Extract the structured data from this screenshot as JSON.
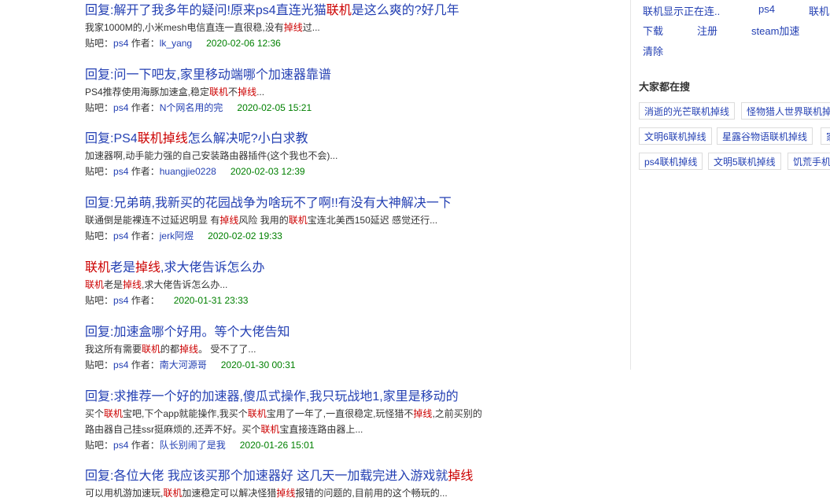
{
  "results": [
    {
      "title": "回复:解开了我多年的疑问!原来ps4直连光猫联机是这么爽的?好几年",
      "snippet": "我家1000M的,小米mesh电信直连一直很稳,没有掉线过...",
      "bar_label": "贴吧：",
      "bar": "ps4",
      "author_label": "作者：",
      "author": "lk_yang",
      "date": "2020-02-06 12:36"
    },
    {
      "title": "回复:问一下吧友,家里移动端哪个加速器靠谱",
      "snippet": "PS4推荐使用海豚加速盒,稳定联机不掉线...",
      "bar_label": "贴吧：",
      "bar": "ps4",
      "author_label": "作者：",
      "author": "N个网名用的完",
      "date": "2020-02-05 15:21"
    },
    {
      "title": "回复:PS4联机掉线怎么解决呢?小白求教",
      "snippet": "加速器啊,动手能力强的自己安装路由器插件(这个我也不会)...",
      "bar_label": "贴吧：",
      "bar": "ps4",
      "author_label": "作者：",
      "author": "huangjie0228",
      "date": "2020-02-03 12:39"
    },
    {
      "title": "回复:兄弟萌,我新买的花园战争为啥玩不了啊!!有没有大神解决一下",
      "snippet": "联通倒是能裸连不过延迟明显 有掉线风险 我用的联机宝连北美西150延迟 感觉还行...",
      "bar_label": "贴吧：",
      "bar": "ps4",
      "author_label": "作者：",
      "author": "jerk阿煜",
      "date": "2020-02-02 19:33"
    },
    {
      "title": "联机老是掉线,求大佬告诉怎么办",
      "snippet": "联机老是掉线,求大佬告诉怎么办...",
      "bar_label": "贴吧：",
      "bar": "ps4",
      "author_label": "作者：",
      "author": "",
      "date": "2020-01-31 23:33"
    },
    {
      "title": "回复:加速盒哪个好用。等个大佬告知",
      "snippet": "我这所有需要联机的都掉线。 受不了了...",
      "bar_label": "贴吧：",
      "bar": "ps4",
      "author_label": "作者：",
      "author": "南大河源哥",
      "date": "2020-01-30 00:31"
    },
    {
      "title": "回复:求推荐一个好的加速器,傻瓜式操作,我只玩战地1,家里是移动的",
      "snippet": "买个联机宝吧,下个app就能操作,我买个联机宝用了一年了,一直很稳定,玩怪猎不掉线,之前买别的路由器自己挂ssr挺麻烦的,还弄不好。买个联机宝直接连路由器上...",
      "bar_label": "贴吧：",
      "bar": "ps4",
      "author_label": "作者：",
      "author": "队长别闹了是我",
      "date": "2020-01-26 15:01"
    },
    {
      "title": "回复:各位大佬 我应该买那个加速器好 这几天一加载完进入游戏就掉线",
      "snippet": "可以用机游加速玩,联机加速稳定可以解决怪猎掉线报错的问题的,目前用的这个畅玩的...",
      "bar_label": "贴吧：",
      "bar": "ps4",
      "author_label": "作者：",
      "author": "",
      "date": ""
    }
  ],
  "highlight_terms": [
    "联机",
    "掉线"
  ],
  "sidebar": {
    "related": [
      [
        "联机显示正在连..",
        "ps4",
        "联机"
      ],
      [
        "下载",
        "注册",
        "steam加速"
      ],
      [
        "清除"
      ]
    ],
    "hot_title": "大家都在搜",
    "hot_rows": [
      [
        "消逝的光芒联机掉线",
        "怪物猎人世界联机掉线"
      ],
      [
        "文明6联机掉线",
        "星露谷物语联机掉线",
        "家"
      ],
      [
        "ps4联机掉线",
        "文明5联机掉线",
        "饥荒手机"
      ]
    ]
  },
  "colors": {
    "link": "#2440b3",
    "highlight": "#cc0000",
    "date": "#008000"
  }
}
